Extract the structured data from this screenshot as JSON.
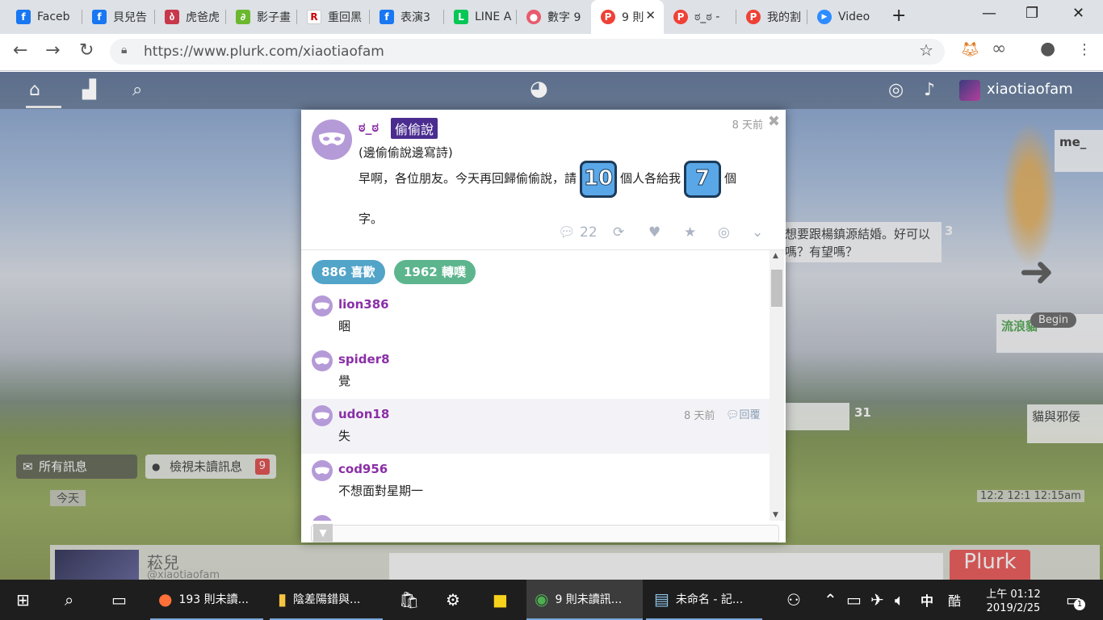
{
  "browser": {
    "tabs": [
      {
        "label": "Faceb",
        "icon": "facebook-icon",
        "color": "#1877f2",
        "glyph": "f"
      },
      {
        "label": "貝兒告",
        "icon": "facebook-icon",
        "color": "#1877f2",
        "glyph": "f"
      },
      {
        "label": "虎爸虎",
        "icon": "tiger-icon",
        "color": "#c8384a",
        "glyph": "ბ"
      },
      {
        "label": "影子畫",
        "icon": "leaf-icon",
        "color": "#6bb82e",
        "glyph": "∂"
      },
      {
        "label": "重回黑",
        "icon": "r-icon",
        "color": "#cc0000",
        "glyph": "R"
      },
      {
        "label": "表演3",
        "icon": "facebook-icon",
        "color": "#1877f2",
        "glyph": "f"
      },
      {
        "label": "LINE A",
        "icon": "line-icon",
        "color": "#06c755",
        "glyph": "L"
      },
      {
        "label": "數字 9",
        "icon": "pig-icon",
        "color": "#e85a6e",
        "glyph": "●"
      },
      {
        "label": "9 則",
        "icon": "plurk-icon",
        "color": "#ef4136",
        "glyph": "P",
        "active": true
      },
      {
        "label": "ಠ_ಠ -",
        "icon": "plurk-icon",
        "color": "#ef4136",
        "glyph": "P"
      },
      {
        "label": "我的割",
        "icon": "plurk-icon",
        "color": "#ef4136",
        "glyph": "P"
      },
      {
        "label": "Video",
        "icon": "zoom-icon",
        "color": "#2d8cff",
        "glyph": "▶"
      }
    ],
    "url": "https://www.plurk.com/xiaotiaofam"
  },
  "plurk_nav": {
    "username": "xiaotiaofam"
  },
  "popup": {
    "author": "ಠ_ಠ",
    "qualifier": "偷偷說",
    "time": "8 天前",
    "subtitle": "(邊偷偷說邊寫詩)",
    "body_part1": "早啊，各位朋友。今天再回歸偷偷說，請",
    "num1": "10",
    "body_part2": "個人各給我",
    "num2": "7",
    "body_part3": "個",
    "body_line2": "字。",
    "response_count": "22",
    "likes": "886 喜歡",
    "replurks": "1962 轉噗",
    "likes_color": "#52a4c8",
    "replurks_color": "#5db58e",
    "responses": [
      {
        "name": "lion386",
        "text": "睏"
      },
      {
        "name": "spider8",
        "text": "覺"
      },
      {
        "name": "udon18",
        "text": "失",
        "time": "8 天前",
        "reply": "回覆"
      },
      {
        "name": "cod956",
        "text": "不想面對星期一"
      }
    ]
  },
  "background": {
    "feed_snippet": "想要跟楊鎮源結婚。好可以嗎？有望嗎？",
    "feed_count": "3",
    "feed_count2": "31",
    "right_user": "me_",
    "right_user2": "貓與邪佞",
    "right_user3": "流浪貓",
    "begin_label": "Begin",
    "all_msgs": "所有訊息",
    "unread_msgs": "檢視未讀訊息",
    "unread_count": "9",
    "today": "今天",
    "times": "12:2 12:1 12:15am",
    "plurk_button": "Plurk",
    "bottom_user": "菘兒",
    "bottom_handle": "@xiaotiaofam"
  },
  "taskbar": {
    "apps": [
      {
        "label": "193 則未讀...",
        "icon": "firefox-icon"
      },
      {
        "label": "陰差陽錯與...",
        "icon": "folder-icon"
      },
      {
        "label": "9 則未讀訊...",
        "icon": "chrome-icon"
      },
      {
        "label": "未命名 - 記...",
        "icon": "notepad-icon"
      }
    ],
    "ime": "中",
    "ime2": "酷",
    "time": "上午 01:12",
    "date": "2019/2/25",
    "notif": "1"
  }
}
